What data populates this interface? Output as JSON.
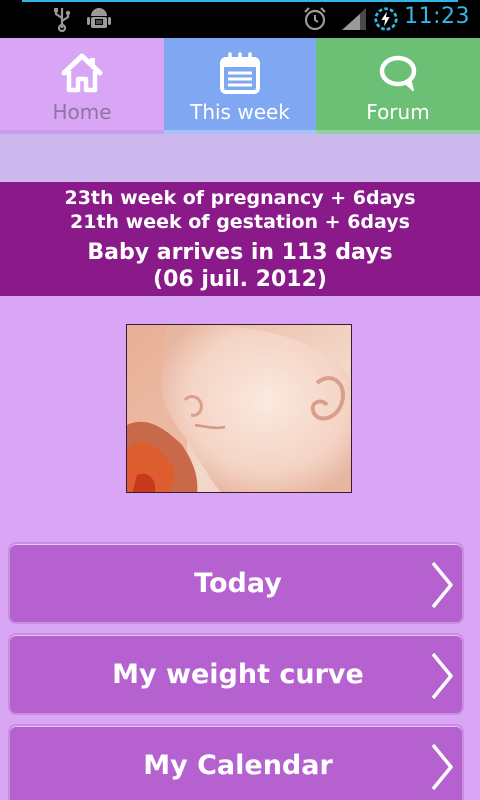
{
  "status_bar": {
    "time": "11:23",
    "icons": [
      "usb-icon",
      "android-debug-icon",
      "alarm-icon",
      "signal-icon",
      "battery-charging-icon"
    ]
  },
  "tabs": [
    {
      "label": "Home",
      "icon": "home-icon"
    },
    {
      "label": "This week",
      "icon": "calendar-icon"
    },
    {
      "label": "Forum",
      "icon": "chat-bubble-icon"
    }
  ],
  "pregnancy_info": {
    "pregnancy_week": "23th week of pregnancy + 6days",
    "gestation_week": "21th week of gestation + 6days",
    "countdown": "Baby arrives in 113 days",
    "due_date": "(06 juil. 2012)"
  },
  "menu": [
    {
      "label": "Today"
    },
    {
      "label": "My weight curve"
    },
    {
      "label": "My Calendar"
    }
  ],
  "colors": {
    "background": "#d9a6f5",
    "banner": "#8a1a8a",
    "button": "#b561d0",
    "tab_week": "#7fa7f2",
    "tab_forum": "#6cc076",
    "clock": "#35b5e5"
  }
}
